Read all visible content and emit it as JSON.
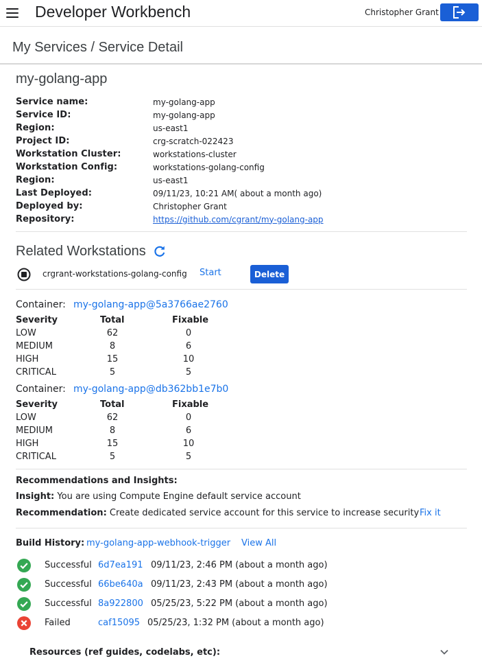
{
  "header": {
    "app_title": "Developer Workbench",
    "user_name": "Christopher Grant",
    "menu_icon": "hamburger-menu-icon",
    "logout_icon": "logout-icon"
  },
  "breadcrumb": "My Services / Service Detail",
  "service": {
    "title": "my-golang-app",
    "details": [
      {
        "label": "Service name:",
        "value": "my-golang-app"
      },
      {
        "label": "Service ID:",
        "value": "my-golang-app"
      },
      {
        "label": "Region:",
        "value": "us-east1"
      },
      {
        "label": "Project ID:",
        "value": "crg-scratch-022423"
      },
      {
        "label": "Workstation Cluster:",
        "value": "workstations-cluster"
      },
      {
        "label": "Workstation Config:",
        "value": "workstations-golang-config"
      },
      {
        "label": "Region:",
        "value": "us-east1"
      },
      {
        "label": "Last Deployed:",
        "value": "09/11/23, 10:21 AM( about a month ago)"
      },
      {
        "label": "Deployed by:",
        "value": "Christopher Grant"
      },
      {
        "label": "Repository:",
        "value": "https://github.com/cgrant/my-golang-app"
      }
    ]
  },
  "related": {
    "title": "Related Workstations",
    "refresh_icon": "refresh-icon",
    "workstation": {
      "name": "crgrant-workstations-golang-config",
      "start_label": "Start",
      "delete_label": "Delete",
      "status_icon": "stop-circle-icon"
    }
  },
  "containers": [
    {
      "label": "Container:",
      "image": "my-golang-app@5a3766ae2760",
      "headers": [
        "Severity",
        "Total",
        "Fixable"
      ],
      "rows": [
        [
          "LOW",
          "62",
          "0"
        ],
        [
          "MEDIUM",
          "8",
          "6"
        ],
        [
          "HIGH",
          "15",
          "10"
        ],
        [
          "CRITICAL",
          "5",
          "5"
        ]
      ]
    },
    {
      "label": "Container:",
      "image": "my-golang-app@db362bb1e7b0",
      "headers": [
        "Severity",
        "Total",
        "Fixable"
      ],
      "rows": [
        [
          "LOW",
          "62",
          "0"
        ],
        [
          "MEDIUM",
          "8",
          "6"
        ],
        [
          "HIGH",
          "15",
          "10"
        ],
        [
          "CRITICAL",
          "5",
          "5"
        ]
      ]
    }
  ],
  "recommendations": {
    "title": "Recommendations and Insights:",
    "insight_label": "Insight:",
    "insight_text": "You are using Compute Engine default service account",
    "rec_label": "Recommendation:",
    "rec_text": "Create dedicated service account for this service to increase security",
    "fix_label": "Fix it"
  },
  "build_history": {
    "label": "Build History:",
    "trigger": "my-golang-app-webhook-trigger",
    "view_all": "View All",
    "builds": [
      {
        "status": "Successful",
        "commit": "6d7ea191",
        "time": "09/11/23, 2:46 PM (about a month ago)",
        "icon": "success-check-icon"
      },
      {
        "status": "Successful",
        "commit": "66be640a",
        "time": "09/11/23, 2:43 PM (about a month ago)",
        "icon": "success-check-icon"
      },
      {
        "status": "Successful",
        "commit": "8a922800",
        "time": "05/25/23, 5:22 PM (about a month ago)",
        "icon": "success-check-icon"
      },
      {
        "status": "Failed",
        "commit": "caf15095",
        "time": "05/25/23, 1:32 PM (about a month ago)",
        "icon": "failed-x-icon"
      }
    ]
  },
  "resources": {
    "label": "Resources (ref guides, codelabs, etc):",
    "icon": "chevron-down-icon"
  },
  "colors": {
    "primary": "#1a5fd6",
    "link": "#1a73e8",
    "success": "#34a853",
    "error": "#ea4335"
  }
}
